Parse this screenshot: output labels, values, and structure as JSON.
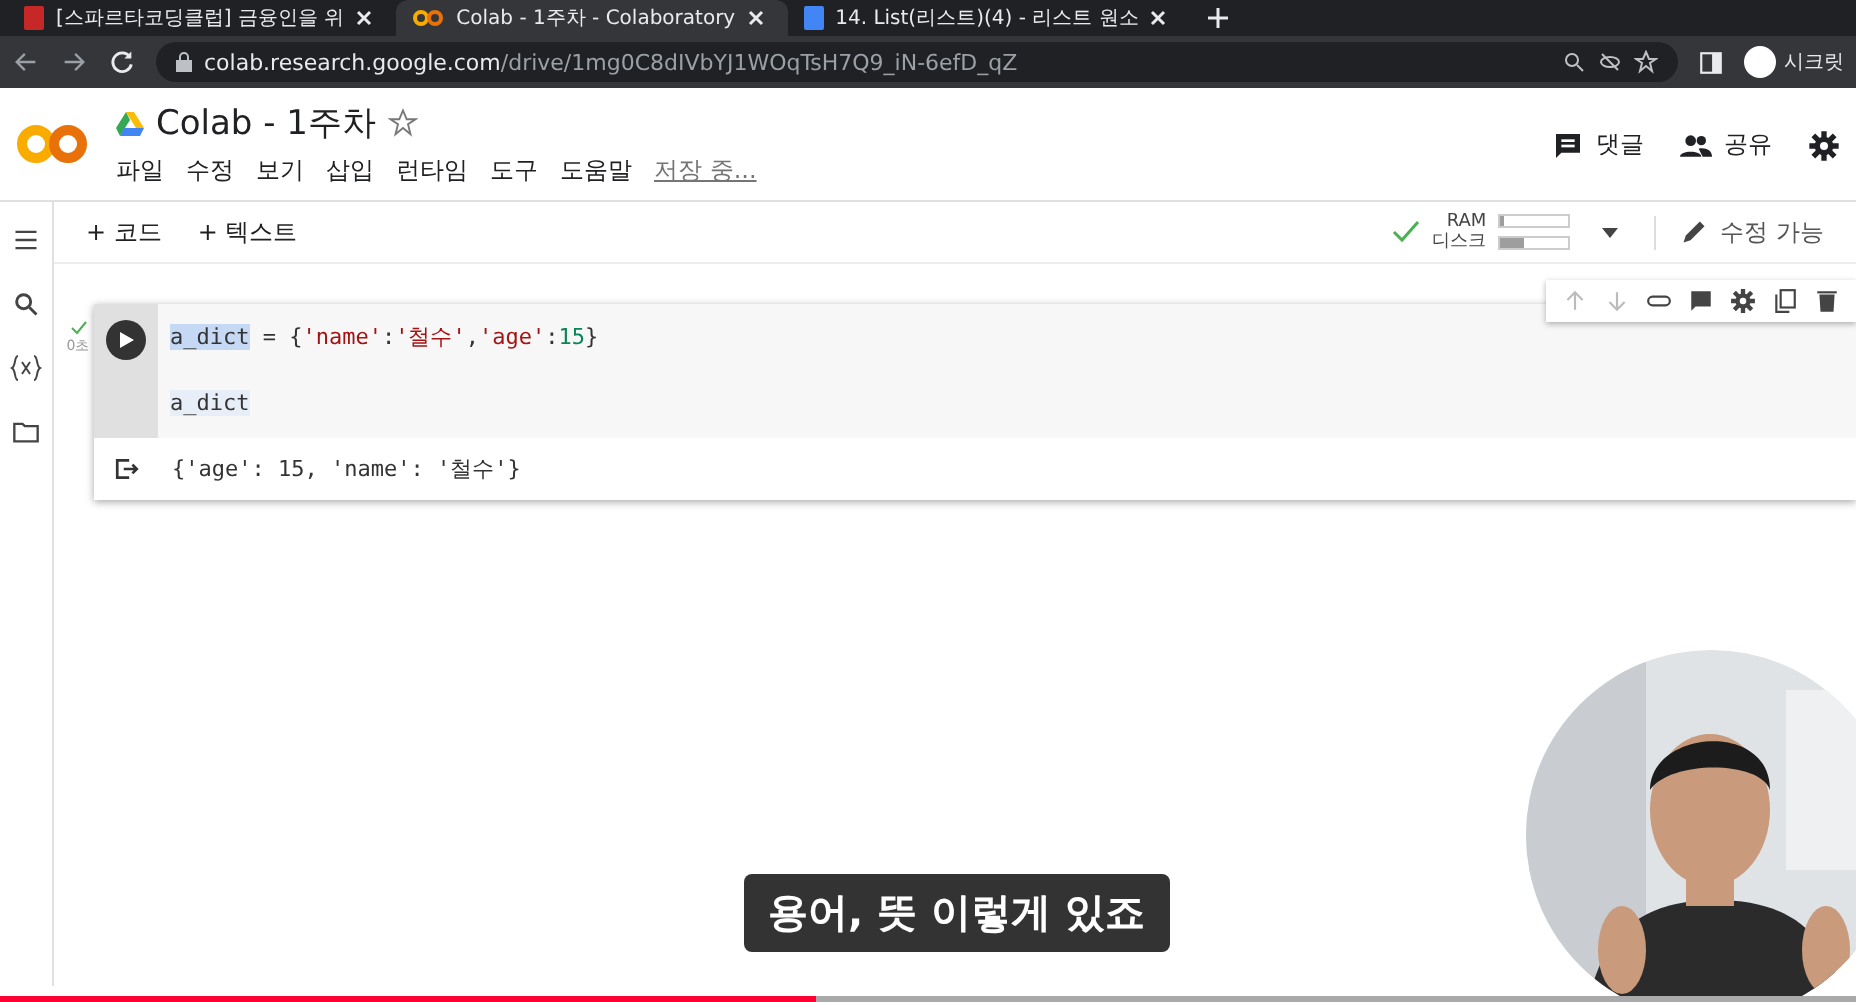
{
  "browser": {
    "tabs": [
      {
        "title": "[스파르타코딩클럽] 금융인을 위",
        "selected": false
      },
      {
        "title": "Colab - 1주차 - Colaboratory",
        "selected": true
      },
      {
        "title": "14. List(리스트)(4) - 리스트 원소",
        "selected": false
      }
    ],
    "url_host": "colab.research.google.com",
    "url_path": "/drive/1mg0C8dIVbYJ1WOqTsH7Q9_iN-6efD_qZ",
    "profile": "시크릿"
  },
  "notebook": {
    "title": "Colab - 1주차",
    "menus": [
      "파일",
      "수정",
      "보기",
      "삽입",
      "런타임",
      "도구",
      "도움말"
    ],
    "save_status": "저장 중...",
    "actions": [
      {
        "kind": "comment",
        "label": "댓글"
      },
      {
        "kind": "share",
        "label": "공유"
      }
    ]
  },
  "toolbar": {
    "add": [
      "+ 코드",
      "+ 텍스트"
    ],
    "ram": {
      "label": "RAM",
      "level": 0.05
    },
    "disk": {
      "label": "디스크",
      "level": 0.35
    },
    "mode": "수정 가능"
  },
  "cell": {
    "exec_time": "0초",
    "code": [
      [
        {
          "text": "a_dict",
          "kind": "highlight"
        },
        {
          "text": " = {",
          "kind": "plain"
        },
        {
          "text": "'name'",
          "kind": "string"
        },
        {
          "text": ":",
          "kind": "plain"
        },
        {
          "text": "'철수'",
          "kind": "string"
        },
        {
          "text": ",",
          "kind": "plain"
        },
        {
          "text": "'age'",
          "kind": "string"
        },
        {
          "text": ":",
          "kind": "plain"
        },
        {
          "text": "15",
          "kind": "number"
        },
        {
          "text": "}",
          "kind": "plain"
        }
      ],
      [
        {
          "text": "a_dict",
          "kind": "soft"
        }
      ]
    ],
    "output": "{'age': 15, 'name': '철수'}"
  },
  "subtitle": "용어, 뜻 이렇게 있죠",
  "video_progress": {
    "level": 0.44
  }
}
